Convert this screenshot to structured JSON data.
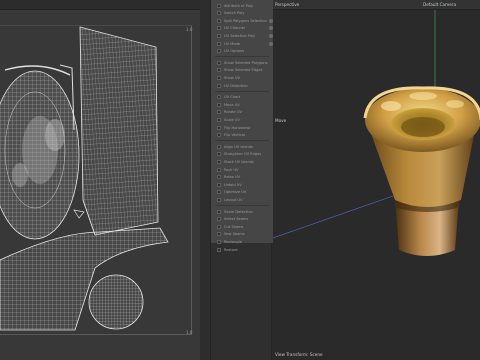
{
  "uv_editor": {
    "tick_top": "1.0",
    "tick_bottom": "1.0"
  },
  "attribute_list": {
    "rows": [
      "Attribute of Poly",
      "Switch Poly",
      "Split Polygons Selection",
      "UV Channel",
      "UV Selection Poly",
      "UV Mode",
      "UV Options",
      "Show Selected Polygons",
      "Show Selected Edges",
      "Show UV",
      "UV Distortion",
      "UV Chart",
      "Move UV",
      "Rotate UV",
      "Scale UV",
      "Flip Horizontal",
      "Flip Vertical",
      "Align UV Islands",
      "Straighten UV Edges",
      "Stack UV Islands",
      "Pack UV",
      "Relax UV",
      "Unfold UV",
      "Optimize UV",
      "Layout UV",
      "Seam Detection",
      "Select Seams",
      "Cut Seams",
      "Sew Seams",
      "Rectangle",
      "Restore"
    ]
  },
  "viewport": {
    "view_name": "Perspective",
    "camera_name": "Default Camera",
    "move_label": "Move",
    "status_text": "View Transform: Scene"
  }
}
